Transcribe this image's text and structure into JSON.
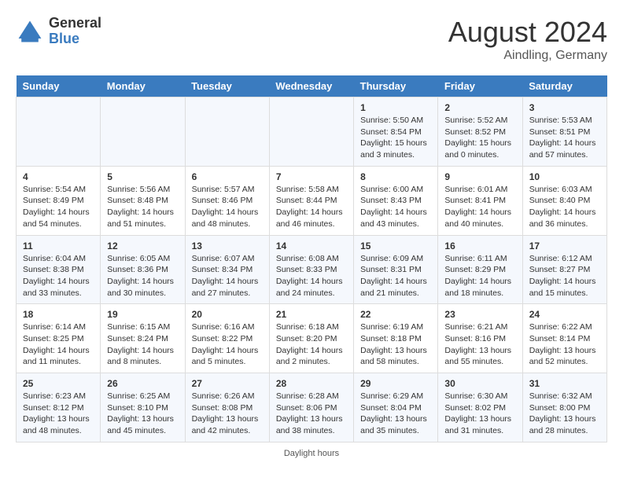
{
  "header": {
    "logo_general": "General",
    "logo_blue": "Blue",
    "month_year": "August 2024",
    "location": "Aindling, Germany"
  },
  "days_of_week": [
    "Sunday",
    "Monday",
    "Tuesday",
    "Wednesday",
    "Thursday",
    "Friday",
    "Saturday"
  ],
  "footer": {
    "note": "Daylight hours"
  },
  "weeks": [
    [
      {
        "day": "",
        "sunrise": "",
        "sunset": "",
        "daylight": ""
      },
      {
        "day": "",
        "sunrise": "",
        "sunset": "",
        "daylight": ""
      },
      {
        "day": "",
        "sunrise": "",
        "sunset": "",
        "daylight": ""
      },
      {
        "day": "",
        "sunrise": "",
        "sunset": "",
        "daylight": ""
      },
      {
        "day": "1",
        "sunrise": "Sunrise: 5:50 AM",
        "sunset": "Sunset: 8:54 PM",
        "daylight": "Daylight: 15 hours and 3 minutes."
      },
      {
        "day": "2",
        "sunrise": "Sunrise: 5:52 AM",
        "sunset": "Sunset: 8:52 PM",
        "daylight": "Daylight: 15 hours and 0 minutes."
      },
      {
        "day": "3",
        "sunrise": "Sunrise: 5:53 AM",
        "sunset": "Sunset: 8:51 PM",
        "daylight": "Daylight: 14 hours and 57 minutes."
      }
    ],
    [
      {
        "day": "4",
        "sunrise": "Sunrise: 5:54 AM",
        "sunset": "Sunset: 8:49 PM",
        "daylight": "Daylight: 14 hours and 54 minutes."
      },
      {
        "day": "5",
        "sunrise": "Sunrise: 5:56 AM",
        "sunset": "Sunset: 8:48 PM",
        "daylight": "Daylight: 14 hours and 51 minutes."
      },
      {
        "day": "6",
        "sunrise": "Sunrise: 5:57 AM",
        "sunset": "Sunset: 8:46 PM",
        "daylight": "Daylight: 14 hours and 48 minutes."
      },
      {
        "day": "7",
        "sunrise": "Sunrise: 5:58 AM",
        "sunset": "Sunset: 8:44 PM",
        "daylight": "Daylight: 14 hours and 46 minutes."
      },
      {
        "day": "8",
        "sunrise": "Sunrise: 6:00 AM",
        "sunset": "Sunset: 8:43 PM",
        "daylight": "Daylight: 14 hours and 43 minutes."
      },
      {
        "day": "9",
        "sunrise": "Sunrise: 6:01 AM",
        "sunset": "Sunset: 8:41 PM",
        "daylight": "Daylight: 14 hours and 40 minutes."
      },
      {
        "day": "10",
        "sunrise": "Sunrise: 6:03 AM",
        "sunset": "Sunset: 8:40 PM",
        "daylight": "Daylight: 14 hours and 36 minutes."
      }
    ],
    [
      {
        "day": "11",
        "sunrise": "Sunrise: 6:04 AM",
        "sunset": "Sunset: 8:38 PM",
        "daylight": "Daylight: 14 hours and 33 minutes."
      },
      {
        "day": "12",
        "sunrise": "Sunrise: 6:05 AM",
        "sunset": "Sunset: 8:36 PM",
        "daylight": "Daylight: 14 hours and 30 minutes."
      },
      {
        "day": "13",
        "sunrise": "Sunrise: 6:07 AM",
        "sunset": "Sunset: 8:34 PM",
        "daylight": "Daylight: 14 hours and 27 minutes."
      },
      {
        "day": "14",
        "sunrise": "Sunrise: 6:08 AM",
        "sunset": "Sunset: 8:33 PM",
        "daylight": "Daylight: 14 hours and 24 minutes."
      },
      {
        "day": "15",
        "sunrise": "Sunrise: 6:09 AM",
        "sunset": "Sunset: 8:31 PM",
        "daylight": "Daylight: 14 hours and 21 minutes."
      },
      {
        "day": "16",
        "sunrise": "Sunrise: 6:11 AM",
        "sunset": "Sunset: 8:29 PM",
        "daylight": "Daylight: 14 hours and 18 minutes."
      },
      {
        "day": "17",
        "sunrise": "Sunrise: 6:12 AM",
        "sunset": "Sunset: 8:27 PM",
        "daylight": "Daylight: 14 hours and 15 minutes."
      }
    ],
    [
      {
        "day": "18",
        "sunrise": "Sunrise: 6:14 AM",
        "sunset": "Sunset: 8:25 PM",
        "daylight": "Daylight: 14 hours and 11 minutes."
      },
      {
        "day": "19",
        "sunrise": "Sunrise: 6:15 AM",
        "sunset": "Sunset: 8:24 PM",
        "daylight": "Daylight: 14 hours and 8 minutes."
      },
      {
        "day": "20",
        "sunrise": "Sunrise: 6:16 AM",
        "sunset": "Sunset: 8:22 PM",
        "daylight": "Daylight: 14 hours and 5 minutes."
      },
      {
        "day": "21",
        "sunrise": "Sunrise: 6:18 AM",
        "sunset": "Sunset: 8:20 PM",
        "daylight": "Daylight: 14 hours and 2 minutes."
      },
      {
        "day": "22",
        "sunrise": "Sunrise: 6:19 AM",
        "sunset": "Sunset: 8:18 PM",
        "daylight": "Daylight: 13 hours and 58 minutes."
      },
      {
        "day": "23",
        "sunrise": "Sunrise: 6:21 AM",
        "sunset": "Sunset: 8:16 PM",
        "daylight": "Daylight: 13 hours and 55 minutes."
      },
      {
        "day": "24",
        "sunrise": "Sunrise: 6:22 AM",
        "sunset": "Sunset: 8:14 PM",
        "daylight": "Daylight: 13 hours and 52 minutes."
      }
    ],
    [
      {
        "day": "25",
        "sunrise": "Sunrise: 6:23 AM",
        "sunset": "Sunset: 8:12 PM",
        "daylight": "Daylight: 13 hours and 48 minutes."
      },
      {
        "day": "26",
        "sunrise": "Sunrise: 6:25 AM",
        "sunset": "Sunset: 8:10 PM",
        "daylight": "Daylight: 13 hours and 45 minutes."
      },
      {
        "day": "27",
        "sunrise": "Sunrise: 6:26 AM",
        "sunset": "Sunset: 8:08 PM",
        "daylight": "Daylight: 13 hours and 42 minutes."
      },
      {
        "day": "28",
        "sunrise": "Sunrise: 6:28 AM",
        "sunset": "Sunset: 8:06 PM",
        "daylight": "Daylight: 13 hours and 38 minutes."
      },
      {
        "day": "29",
        "sunrise": "Sunrise: 6:29 AM",
        "sunset": "Sunset: 8:04 PM",
        "daylight": "Daylight: 13 hours and 35 minutes."
      },
      {
        "day": "30",
        "sunrise": "Sunrise: 6:30 AM",
        "sunset": "Sunset: 8:02 PM",
        "daylight": "Daylight: 13 hours and 31 minutes."
      },
      {
        "day": "31",
        "sunrise": "Sunrise: 6:32 AM",
        "sunset": "Sunset: 8:00 PM",
        "daylight": "Daylight: 13 hours and 28 minutes."
      }
    ]
  ]
}
